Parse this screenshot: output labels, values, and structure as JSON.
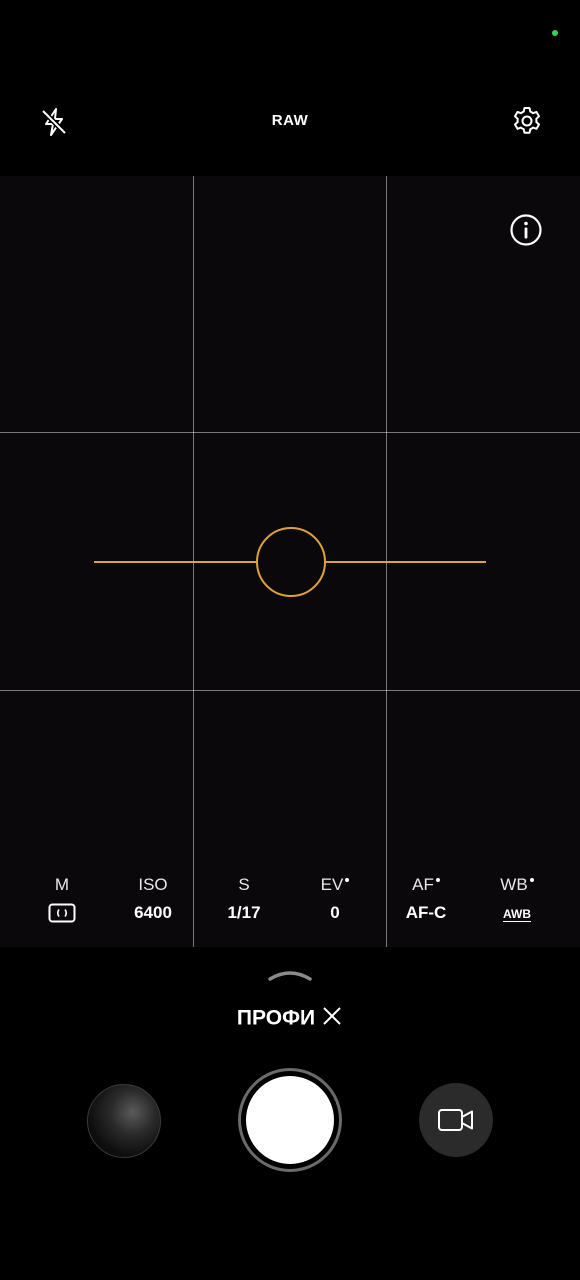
{
  "top_bar": {
    "flash_icon": "flash-off-icon",
    "format_label": "RAW",
    "settings_icon": "gear-icon"
  },
  "viewfinder": {
    "info_icon": "info-icon",
    "level_color": "#e0a336"
  },
  "pro_controls": [
    {
      "label": "M",
      "value": "",
      "value_icon": "metering-icon",
      "dot": false
    },
    {
      "label": "ISO",
      "value": "6400",
      "dot": false
    },
    {
      "label": "S",
      "value": "1/17",
      "dot": false
    },
    {
      "label": "EV",
      "value": "0",
      "dot": true
    },
    {
      "label": "AF",
      "value": "AF-C",
      "dot": true
    },
    {
      "label": "WB",
      "value": "AWB",
      "dot": true
    }
  ],
  "bottom": {
    "mode_label": "ПРОФИ",
    "close_icon": "close-icon",
    "expand_icon": "chevron-up-icon",
    "video_icon": "video-camera-icon"
  },
  "colors": {
    "status_indicator": "#3ad15a",
    "accent": "#e0a336"
  }
}
